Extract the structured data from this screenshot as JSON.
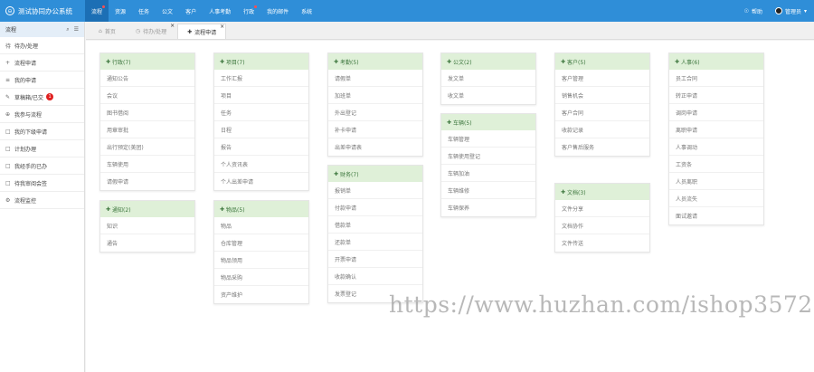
{
  "app": {
    "title": "测试协同办公系统"
  },
  "topnav": [
    {
      "label": "流程",
      "active": true,
      "dot": true
    },
    {
      "label": "资源",
      "active": false,
      "dot": false
    },
    {
      "label": "任务",
      "active": false,
      "dot": false
    },
    {
      "label": "公文",
      "active": false,
      "dot": false
    },
    {
      "label": "客户",
      "active": false,
      "dot": false
    },
    {
      "label": "人事考勤",
      "active": false,
      "dot": false
    },
    {
      "label": "行政",
      "active": false,
      "dot": true
    },
    {
      "label": "我的邮件",
      "active": false,
      "dot": false
    },
    {
      "label": "系统",
      "active": false,
      "dot": false
    }
  ],
  "topright": {
    "help": "帮助",
    "user": "管理员"
  },
  "sidebar": {
    "title": "流程",
    "items": [
      {
        "icon": "待",
        "label": "待办/处理"
      },
      {
        "icon": "+",
        "label": "流程申请"
      },
      {
        "icon": "≡",
        "label": "我的申请"
      },
      {
        "icon": "✎",
        "label": "草稿箱/已交",
        "badge": "1"
      },
      {
        "icon": "⊕",
        "label": "我参与流程"
      },
      {
        "icon": "□",
        "label": "我的下级申请"
      },
      {
        "icon": "□",
        "label": "计划办理"
      },
      {
        "icon": "□",
        "label": "我经手的已办"
      },
      {
        "icon": "□",
        "label": "待我审阅会签"
      },
      {
        "icon": "⚙",
        "label": "流程监控"
      }
    ]
  },
  "tabs": [
    {
      "label": "首页",
      "icon": "⌂",
      "active": false,
      "closable": false
    },
    {
      "label": "待办/处理",
      "icon": "◷",
      "active": false,
      "closable": true
    },
    {
      "label": "流程申请",
      "icon": "✚",
      "active": true,
      "closable": true
    }
  ],
  "cards": [
    {
      "title": "行政(7)",
      "items": [
        "通知公告",
        "会议",
        "图书借阅",
        "用章审批",
        "出行预定(美团)",
        "车辆使用",
        "请假申请"
      ]
    },
    {
      "title": "项目(7)",
      "items": [
        "工作汇报",
        "项目",
        "任务",
        "日程",
        "报告",
        "个人资讯表",
        "个人出差申请"
      ]
    },
    {
      "title": "考勤(5)",
      "items": [
        "请假单",
        "加班单",
        "外出登记",
        "补卡申请",
        "出差申请表"
      ]
    },
    {
      "title": "公文(2)",
      "items": [
        "发文单",
        "收文单"
      ]
    },
    {
      "title": "客户(5)",
      "items": [
        "客户管理",
        "销售机会",
        "客户合同",
        "收款记录",
        "客户售后服务"
      ]
    },
    {
      "title": "人事(6)",
      "items": [
        "员工合同",
        "转正申请",
        "调岗申请",
        "离职申请",
        "人事调动",
        "工资条"
      ]
    },
    {
      "title": "通知(2)",
      "items": [
        "知识",
        "通告"
      ]
    },
    {
      "title": "物品(5)",
      "items": [
        "物品",
        "仓库管理",
        "物品领用",
        "物品采购",
        "资产维护"
      ]
    },
    {
      "title": "财务(7)",
      "items": [
        "报销单",
        "付款申请",
        "借款单",
        "还款单",
        "开票申请",
        "收款确认",
        "发票登记"
      ]
    },
    {
      "title": "车辆(5)",
      "items": [
        "车辆管理",
        "车辆使用登记",
        "车辆加油",
        "车辆维修",
        "车辆保养"
      ]
    },
    {
      "title": "文档(3)",
      "items": [
        "文件分享",
        "文档协作",
        "文件传送"
      ]
    },
    {
      "title": "人员离职",
      "items": [
        "人员流失",
        "面试邀请"
      ],
      "continuation": true
    }
  ],
  "watermark": "https://www.huzhan.com/ishop3572"
}
